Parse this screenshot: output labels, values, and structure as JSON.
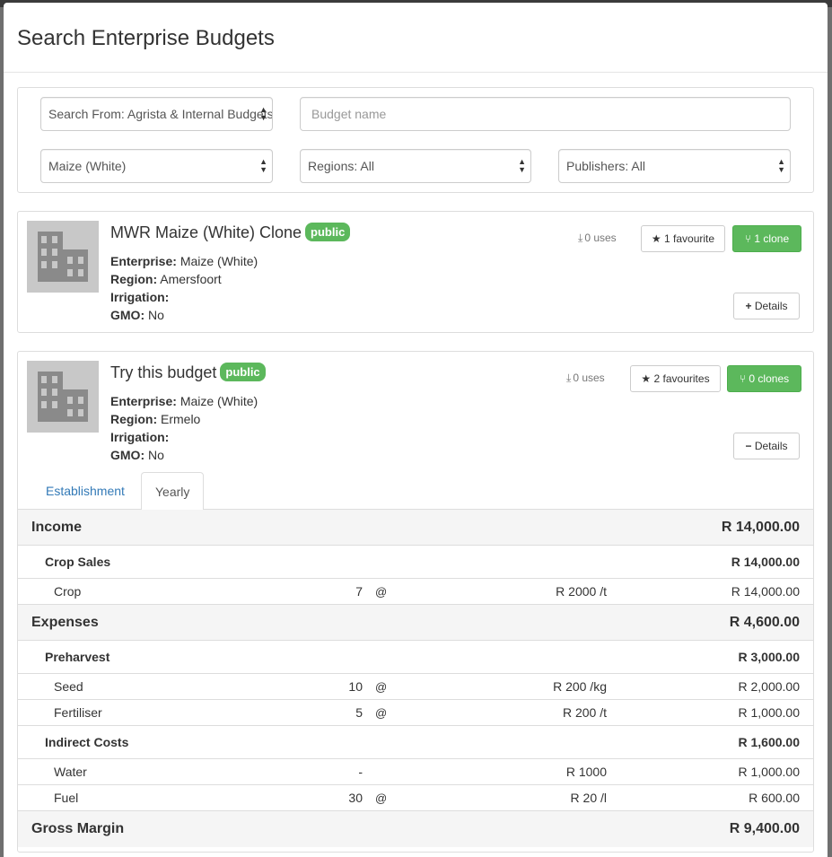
{
  "modal": {
    "title": "Search Enterprise Budgets"
  },
  "filters": {
    "search_from": "Search From: Agrista & Internal Budgets",
    "budget_name_placeholder": "Budget name",
    "commodity": "Maize (White)",
    "regions": "Regions: All",
    "publishers": "Publishers: All"
  },
  "budgets": [
    {
      "title": "MWR Maize (White) Clone",
      "badge": "public",
      "enterprise_label": "Enterprise:",
      "enterprise": "Maize (White)",
      "region_label": "Region:",
      "region": "Amersfoort",
      "irrigation_label": "Irrigation:",
      "irrigation": "",
      "gmo_label": "GMO:",
      "gmo": "No",
      "uses": "0 uses",
      "favourites": "1 favourite",
      "clones": "1 clone",
      "details": "Details",
      "details_icon": "plus-icon"
    },
    {
      "title": "Try this budget",
      "badge": "public",
      "enterprise_label": "Enterprise:",
      "enterprise": "Maize (White)",
      "region_label": "Region:",
      "region": "Ermelo",
      "irrigation_label": "Irrigation:",
      "irrigation": "",
      "gmo_label": "GMO:",
      "gmo": "No",
      "uses": "0 uses",
      "favourites": "2 favourites",
      "clones": "0 clones",
      "details": "Details",
      "details_icon": "minus-icon"
    }
  ],
  "tabs": [
    {
      "label": "Establishment",
      "active": false
    },
    {
      "label": "Yearly",
      "active": true
    }
  ],
  "financials": {
    "income": {
      "label": "Income",
      "total": "R 14,000.00",
      "groups": [
        {
          "label": "Crop Sales",
          "total": "R 14,000.00",
          "items": [
            {
              "label": "Crop",
              "qty": "7",
              "at": "@",
              "rate": "R 2000 /t",
              "amount": "R 14,000.00"
            }
          ]
        }
      ]
    },
    "expenses": {
      "label": "Expenses",
      "total": "R 4,600.00",
      "groups": [
        {
          "label": "Preharvest",
          "total": "R 3,000.00",
          "items": [
            {
              "label": "Seed",
              "qty": "10",
              "at": "@",
              "rate": "R 200 /kg",
              "amount": "R 2,000.00"
            },
            {
              "label": "Fertiliser",
              "qty": "5",
              "at": "@",
              "rate": "R 200 /t",
              "amount": "R 1,000.00"
            }
          ]
        },
        {
          "label": "Indirect Costs",
          "total": "R 1,600.00",
          "items": [
            {
              "label": "Water",
              "qty": "-",
              "at": "",
              "rate": "R 1000",
              "amount": "R 1,000.00"
            },
            {
              "label": "Fuel",
              "qty": "30",
              "at": "@",
              "rate": "R 20 /l",
              "amount": "R 600.00"
            }
          ]
        }
      ]
    },
    "gross_margin": {
      "label": "Gross Margin",
      "total": "R 9,400.00"
    }
  },
  "colors": {
    "accent_green": "#5cb85c",
    "link_blue": "#337ab7",
    "thumb_grey": "#c8c8c8"
  }
}
